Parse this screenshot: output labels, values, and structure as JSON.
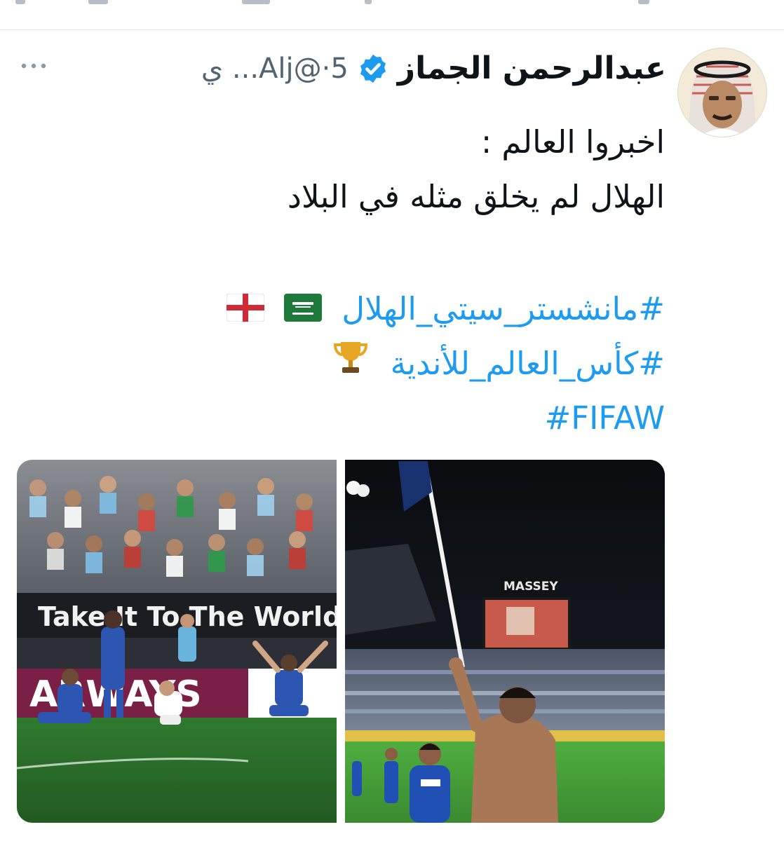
{
  "tweet": {
    "author": {
      "display_name": "عبدالرحمن الجماز",
      "handle_time": "5·@Alj... ي"
    },
    "text_lines": [
      "اخبروا العالم :",
      "الهلال لم يخلق مثله في البلاد"
    ],
    "hashtags": [
      "#مانشستر_سيتي_الهلال",
      "#كأس_العالم_للأندية",
      "#FIFAW"
    ],
    "media": {
      "left_banner_text": "Take It To The World",
      "left_board_text": "ARWAYS",
      "right_board_text": "MASSEY"
    }
  },
  "icons": [
    "verified-badge-icon",
    "more-options-icon",
    "england-flag-emoji",
    "saudi-flag-emoji",
    "trophy-emoji"
  ],
  "colors": {
    "link": "#1d9bf0",
    "verified": "#1d9bf0",
    "text": "#0f1419",
    "muted": "#536471"
  }
}
